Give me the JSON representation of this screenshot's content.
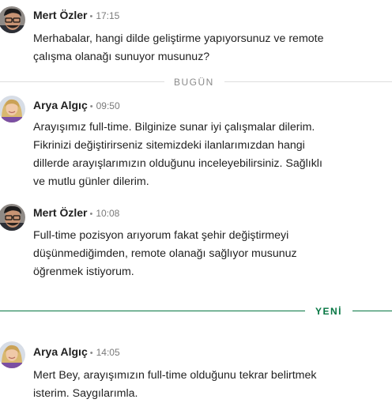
{
  "messages": [
    {
      "author": "Mert Özler",
      "separator": "•",
      "time": "17:15",
      "lines": [
        "Merhabalar, hangi dilde geliştirme yapıyorsunuz ve remote",
        "çalışma olanağı sunuyor musunuz?"
      ]
    },
    {
      "author": "Arya Algıç",
      "separator": "•",
      "time": "09:50",
      "lines": [
        "Arayışımız full-time. Bilginize sunar iyi çalışmalar dilerim.",
        "Fikrinizi değiştirirseniz sitemizdeki ilanlarımızdan hangi",
        "dillerde arayışlarımızın olduğunu inceleyebilirsiniz. Sağlıklı",
        "ve mutlu günler dilerim."
      ]
    },
    {
      "author": "Mert Özler",
      "separator": "•",
      "time": "10:08",
      "lines": [
        "Full-time pozisyon arıyorum fakat şehir değiştirmeyi",
        "düşünmediğimden, remote olanağı sağlıyor musunuz",
        "öğrenmek istiyorum."
      ]
    },
    {
      "author": "Arya Algıç",
      "separator": "•",
      "time": "14:05",
      "lines": [
        "Mert Bey, arayışımızın full-time olduğunu tekrar belirtmek",
        "isterim. Saygılarımla."
      ]
    }
  ],
  "dividers": {
    "today": "BUGÜN",
    "new": "YENİ"
  },
  "colors": {
    "divider_gray": "#dddddd",
    "divider_gray_text": "#8a8a8a",
    "new_accent": "#057642"
  },
  "icons": {
    "mert_avatar": "avatar-photo-man-glasses",
    "arya_avatar": "avatar-photo-woman-blonde"
  }
}
